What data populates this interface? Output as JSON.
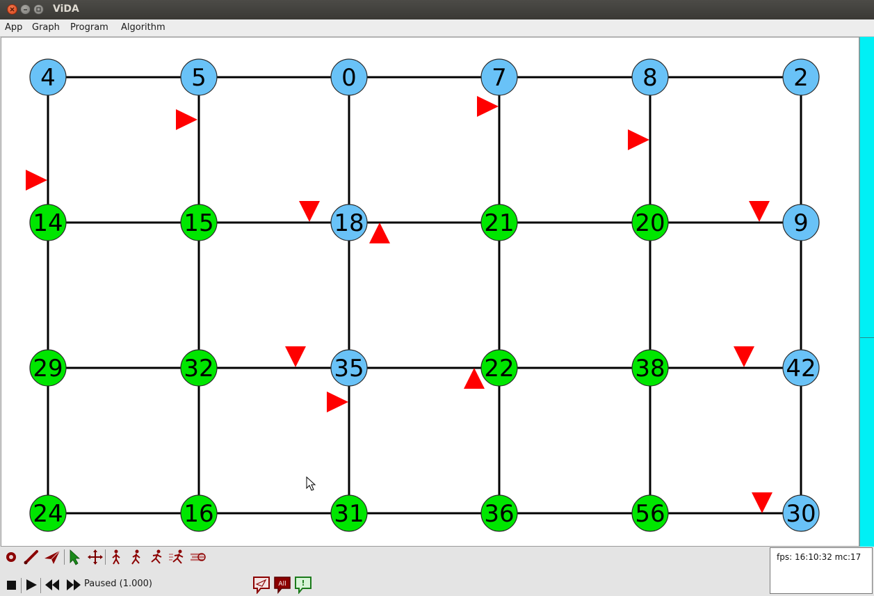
{
  "window": {
    "title": "ViDA"
  },
  "menu": {
    "items": [
      "App",
      "Graph",
      "Program",
      "Algorithm"
    ]
  },
  "colors": {
    "node_blue": "#69c2f7",
    "node_green": "#00e600",
    "edge": "#000000",
    "marker": "#ff0000",
    "scrollbar": "#00f0f5"
  },
  "graph": {
    "rows": [
      [
        "4",
        "5",
        "0",
        "7",
        "8",
        "2"
      ],
      [
        "14",
        "15",
        "18",
        "21",
        "20",
        "9"
      ],
      [
        "29",
        "32",
        "35",
        "22",
        "38",
        "42"
      ],
      [
        "24",
        "16",
        "31",
        "36",
        "56",
        "30"
      ]
    ],
    "blue_nodes": [
      "4",
      "5",
      "0",
      "7",
      "8",
      "2",
      "18",
      "9",
      "35",
      "42",
      "30"
    ]
  },
  "toolbar": {
    "tools": [
      "record-icon",
      "edge-icon",
      "send-icon",
      "pointer-icon",
      "move-icon",
      "walk-slow-icon",
      "walk-icon",
      "run-icon",
      "run-fast-icon",
      "run-blur-icon"
    ],
    "playback": [
      "stop-icon",
      "play-icon",
      "rewind-icon",
      "fast-forward-icon"
    ],
    "messages": [
      "send-message-icon",
      "all-messages-icon",
      "info-message-icon"
    ],
    "all_label": "All",
    "info_label": "!"
  },
  "status": {
    "text": "Paused (1.000)"
  },
  "fps": {
    "text": "fps: 16:10:32 mc:17"
  }
}
